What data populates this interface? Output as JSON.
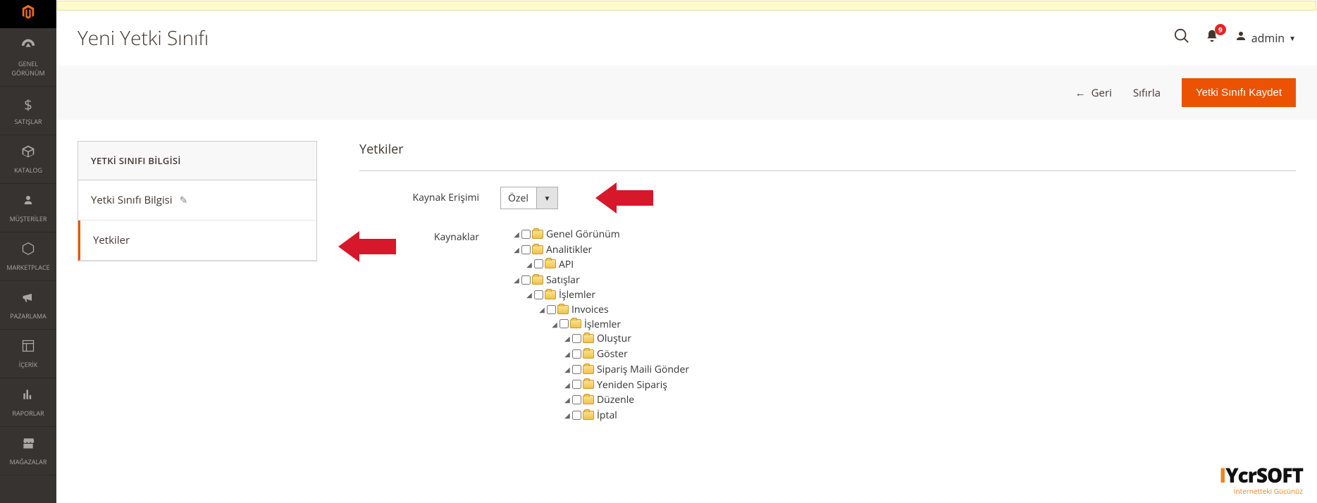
{
  "sidebar": {
    "items": [
      {
        "label": "GENEL GÖRÜNÜM"
      },
      {
        "label": "SATIŞLAR"
      },
      {
        "label": "KATALOG"
      },
      {
        "label": "MÜŞTERİLER"
      },
      {
        "label": "MARKETPLACE"
      },
      {
        "label": "PAZARLAMA"
      },
      {
        "label": "İÇERİK"
      },
      {
        "label": "RAPORLAR"
      },
      {
        "label": "MAĞAZALAR"
      }
    ]
  },
  "header": {
    "title": "Yeni Yetki Sınıfı",
    "admin_label": "admin",
    "notification_count": "9"
  },
  "actions": {
    "back": "Geri",
    "reset": "Sıfırla",
    "save": "Yetki Sınıfı Kaydet"
  },
  "tabs": {
    "section_title": "YETKİ SINIFI BİLGİSİ",
    "items": [
      {
        "label": "Yetki Sınıfı Bilgisi"
      },
      {
        "label": "Yetkiler"
      }
    ]
  },
  "form": {
    "section_title": "Yetkiler",
    "resource_access_label": "Kaynak Erişimi",
    "resource_access_value": "Özel",
    "resources_label": "Kaynaklar"
  },
  "tree": {
    "n0": "Genel Görünüm",
    "n1": "Analitikler",
    "n1_0": "API",
    "n2": "Satışlar",
    "n2_0": "İşlemler",
    "n2_0_0": "Invoices",
    "n2_0_0_0": "İşlemler",
    "n2_0_0_0_0": "Oluştur",
    "n2_0_0_0_1": "Göster",
    "n2_0_0_0_2": "Sipariş Maili Gönder",
    "n2_0_0_0_3": "Yeniden Sipariş",
    "n2_0_0_0_4": "Düzenle",
    "n2_0_0_0_5": "İptal"
  },
  "footer": {
    "brand_prefix": "I",
    "brand_mid": "Ycr",
    "brand_suffix": "SOFT",
    "tagline": "İnternetteki Gücünüz"
  }
}
